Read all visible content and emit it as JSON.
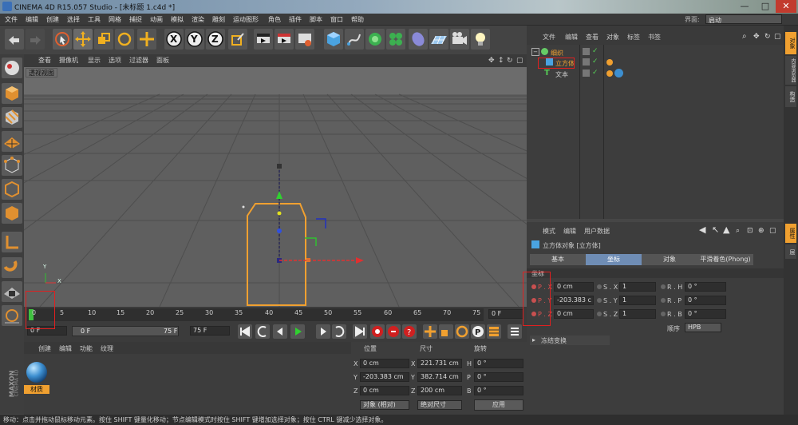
{
  "titlebar": {
    "title": "CINEMA 4D R15.057 Studio - [未标题 1.c4d *]",
    "minimize": "—",
    "maximize": "□",
    "close": "✕"
  },
  "menubar": {
    "items": [
      "文件",
      "编辑",
      "创建",
      "选择",
      "工具",
      "网格",
      "捕捉",
      "动画",
      "模拟",
      "渲染",
      "雕刻",
      "运动图形",
      "角色",
      "插件",
      "脚本",
      "窗口",
      "帮助"
    ],
    "layout_label": "界面:",
    "layout_value": "启动"
  },
  "viewport": {
    "menu": [
      "查看",
      "摄像机",
      "显示",
      "选项",
      "过滤器",
      "面板"
    ],
    "label": "透视视图",
    "axis": {
      "x": "X",
      "y": "Y"
    }
  },
  "timeline": {
    "ticks": [
      "0",
      "5",
      "10",
      "15",
      "20",
      "25",
      "30",
      "35",
      "40",
      "45",
      "50",
      "55",
      "60",
      "65",
      "70",
      "75"
    ],
    "frame_right": "0 F",
    "current": "0 F",
    "range_start": "0 F",
    "range_end": "75 F",
    "max": "75 F"
  },
  "materials": {
    "menu": [
      "创建",
      "编辑",
      "功能",
      "纹理"
    ],
    "material_name": "材质",
    "logo_line1": "MAXON",
    "logo_line2": "CINEMA 4D"
  },
  "coords": {
    "headers": [
      "位置",
      "尺寸",
      "旋转"
    ],
    "rows": [
      {
        "a": "X",
        "av": "0 cm",
        "b": "X",
        "bv": "221.731 cm",
        "c": "H",
        "cv": "0 °"
      },
      {
        "a": "Y",
        "av": "-203.383 cm",
        "b": "Y",
        "bv": "382.714 cm",
        "c": "P",
        "cv": "0 °"
      },
      {
        "a": "Z",
        "av": "0 cm",
        "b": "Z",
        "bv": "200 cm",
        "c": "B",
        "cv": "0 °"
      }
    ],
    "mode_select": "对象 (相对)",
    "size_select": "绝对尺寸",
    "apply": "应用"
  },
  "objmgr": {
    "menu": [
      "文件",
      "编辑",
      "查看",
      "对象",
      "标签",
      "书签"
    ],
    "objects": [
      {
        "name": "细织"
      },
      {
        "name": "立方体"
      },
      {
        "name": "文本"
      }
    ]
  },
  "attrmgr": {
    "menu": [
      "模式",
      "编辑",
      "用户数据"
    ],
    "title": "立方体对象 [立方体]",
    "tabs": [
      "基本",
      "坐标",
      "对象",
      "平滑着色(Phong)"
    ],
    "section": "坐标",
    "rows": [
      {
        "p": "P . X",
        "pv": "0 cm",
        "s": "S . X",
        "sv": "1",
        "r": "R . H",
        "rv": "0 °"
      },
      {
        "p": "P . Y",
        "pv": "-203.383 c",
        "s": "S . Y",
        "sv": "1",
        "r": "R . P",
        "rv": "0 °"
      },
      {
        "p": "P . Z",
        "pv": "0 cm",
        "s": "S . Z",
        "sv": "1",
        "r": "R . B",
        "rv": "0 °"
      }
    ],
    "order_label": "顺序",
    "order_value": "HPB",
    "freeze": "冻结变换"
  },
  "rightstrip": {
    "tabs": [
      "对象",
      "内容浏览器",
      "构造",
      "属性",
      "层"
    ]
  },
  "status": "移动：点击并拖动鼠标移动元素。按住 SHIFT 键量化移动；节点编辑模式时按住 SHIFT 键增加选择对象；按住 CTRL 键减少选择对象。"
}
